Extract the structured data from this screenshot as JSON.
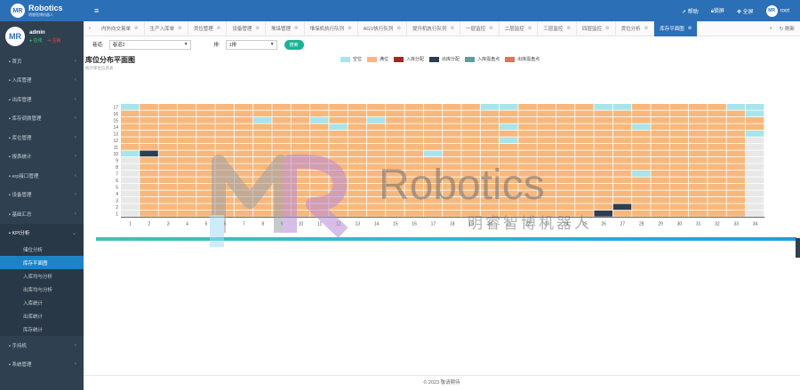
{
  "brand": {
    "logo": "MR",
    "name": "Robotics",
    "tagline": "明睿智博机器人"
  },
  "user": {
    "name": "admin",
    "online": "● 在线",
    "logout": "⇥ 注销"
  },
  "sidebar": {
    "items": [
      {
        "icon": "home-icon",
        "label": "首页"
      },
      {
        "icon": "inbound-icon",
        "label": "入库管理"
      },
      {
        "icon": "outbound-icon",
        "label": "出库管理"
      },
      {
        "icon": "transfer-icon",
        "label": "库存调拨管理"
      },
      {
        "icon": "location-icon",
        "label": "库位管理"
      },
      {
        "icon": "report-icon",
        "label": "报表统计"
      },
      {
        "icon": "erp-icon",
        "label": "erp接口管理"
      },
      {
        "icon": "device-icon",
        "label": "设备管理"
      },
      {
        "icon": "basic-icon",
        "label": "基础汇总"
      },
      {
        "icon": "kpi-icon",
        "label": "KPI分析"
      }
    ],
    "kpi_sub": [
      "储位分析",
      "库存平面图",
      "入库均与分析",
      "出库均与分析",
      "入库统计",
      "出库统计",
      "库存统计"
    ],
    "bottom": [
      {
        "icon": "phone-icon",
        "label": "手持机"
      },
      {
        "icon": "settings-icon",
        "label": "系统管理"
      }
    ]
  },
  "topbar": {
    "help": "帮助",
    "lock": "锁屏",
    "fullscreen": "全屏",
    "username": "root",
    "avatar": "MR"
  },
  "tabs": [
    "内外向交易单",
    "生产入库单",
    "货位管理",
    "设备管理",
    "堆垛管理",
    "堆垛机执行队列",
    "AGV执行队列",
    "提升机执行队列",
    "一层监控",
    "二层监控",
    "三层监控",
    "四层监控",
    "货位分析",
    "库存平面图"
  ],
  "tab_refresh": "刷新",
  "filters": {
    "lane_label": "巷道:",
    "lane_value": "巷道2",
    "side_label": "排:",
    "side_value": "1排",
    "search": "搜索"
  },
  "page": {
    "title": "库位分布平面图",
    "subtitle": "统计库位信息表"
  },
  "legend": [
    {
      "label": "空位",
      "color": "#a8e4ea"
    },
    {
      "label": "满位",
      "color": "#f8b87c"
    },
    {
      "label": "入库分配",
      "color": "#a82424"
    },
    {
      "label": "出库分配",
      "color": "#2c3e50"
    },
    {
      "label": "入库需盘点",
      "color": "#5f9ea0"
    },
    {
      "label": "出库需盘点",
      "color": "#d9775b"
    }
  ],
  "chart_data": {
    "type": "heatmap",
    "title": "库位分布平面图",
    "subtitle": "统计库位信息表",
    "columns": [
      "1",
      "2",
      "3",
      "4",
      "5",
      "6",
      "7",
      "8",
      "9",
      "10",
      "11",
      "12",
      "13",
      "14",
      "15",
      "16",
      "17",
      "18",
      "19",
      "20",
      "21",
      "22",
      "23",
      "24",
      "25",
      "26",
      "27",
      "28",
      "29",
      "30",
      "31",
      "32",
      "33",
      "34"
    ],
    "rows": [
      "1",
      "2",
      "3",
      "4",
      "5",
      "6",
      "7",
      "8",
      "9",
      "10",
      "11",
      "12",
      "13",
      "14",
      "15",
      "16",
      "17"
    ],
    "default_state": "满位",
    "unavailable": [
      {
        "col": 1,
        "rows": [
          1,
          2,
          3,
          4,
          5,
          6,
          7,
          8,
          9
        ]
      },
      {
        "col": 34,
        "rows": [
          1,
          2,
          3,
          4,
          5,
          6,
          7,
          8,
          9,
          10,
          11,
          12
        ]
      }
    ],
    "cells": [
      {
        "col": 1,
        "row": 17,
        "state": "空位"
      },
      {
        "col": 1,
        "row": 10,
        "state": "空位"
      },
      {
        "col": 2,
        "row": 10,
        "state": "出库分配"
      },
      {
        "col": 8,
        "row": 15,
        "state": "空位"
      },
      {
        "col": 11,
        "row": 15,
        "state": "空位"
      },
      {
        "col": 12,
        "row": 14,
        "state": "空位"
      },
      {
        "col": 14,
        "row": 15,
        "state": "空位"
      },
      {
        "col": 17,
        "row": 10,
        "state": "空位"
      },
      {
        "col": 20,
        "row": 17,
        "state": "空位"
      },
      {
        "col": 21,
        "row": 17,
        "state": "空位"
      },
      {
        "col": 21,
        "row": 14,
        "state": "空位"
      },
      {
        "col": 21,
        "row": 12,
        "state": "空位"
      },
      {
        "col": 26,
        "row": 17,
        "state": "空位"
      },
      {
        "col": 26,
        "row": 1,
        "state": "出库分配"
      },
      {
        "col": 27,
        "row": 17,
        "state": "空位"
      },
      {
        "col": 27,
        "row": 2,
        "state": "出库分配"
      },
      {
        "col": 28,
        "row": 14,
        "state": "空位"
      },
      {
        "col": 28,
        "row": 7,
        "state": "空位"
      },
      {
        "col": 33,
        "row": 17,
        "state": "空位"
      },
      {
        "col": 34,
        "row": 17,
        "state": "空位"
      },
      {
        "col": 34,
        "row": 16,
        "state": "空位"
      },
      {
        "col": 34,
        "row": 13,
        "state": "空位"
      }
    ],
    "colors": {
      "空位": "#a8e4ea",
      "满位": "#f8b87c",
      "入库分配": "#a82424",
      "出库分配": "#2c3e50",
      "unavailable": "#e8e8e8"
    }
  },
  "watermark": {
    "brand": "Robotics",
    "cn": "明睿智博机器人"
  },
  "footer": "© 2023 敬请期待"
}
